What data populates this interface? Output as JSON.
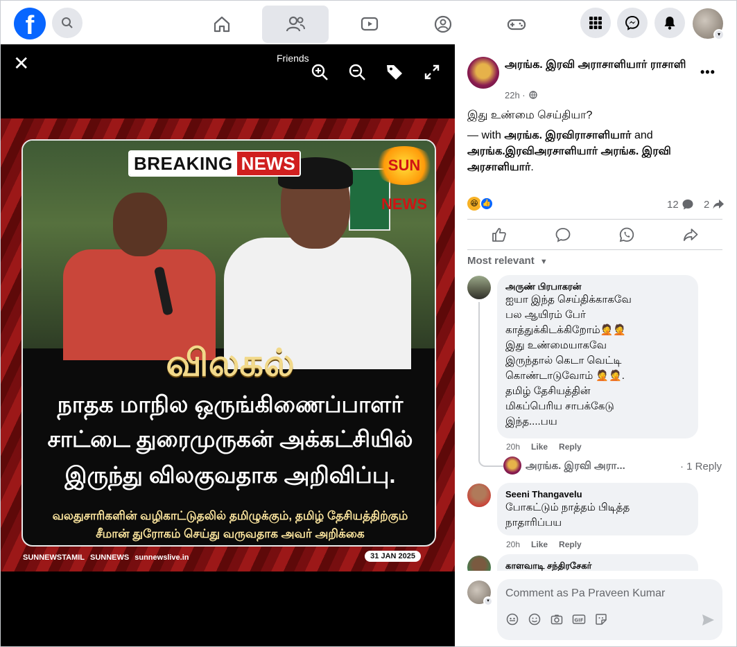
{
  "topbar": {
    "logo_letter": "f",
    "icons": [
      "search-icon",
      "home-icon",
      "friends-icon",
      "video-icon",
      "groups-icon",
      "gaming-icon",
      "menu-grid-icon",
      "messenger-icon",
      "bell-icon"
    ]
  },
  "viewer": {
    "close_glyph": "✕",
    "tooltip": "Friends",
    "photo": {
      "breaking_left": "BREAKING",
      "breaking_right": "NEWS",
      "channel_logo": "SUN NEWS",
      "word": "விலகல்",
      "headline_1": "நாதக மாநில ஒருங்கிணைப்பாளர்",
      "headline_2": "சாட்டை துரைமுருகன் அக்கட்சியில்",
      "headline_3": "இருந்து விலகுவதாக அறிவிப்பு.",
      "sub_1": "வலதுசாரிகளின் வழிகாட்டுதலில் தமிழுக்கும், தமிழ் தேசியத்திற்கும்",
      "sub_2": "சீமான் துரோகம் செய்து வருவதாக அவர் அறிக்கை",
      "footer_1": "SUNNEWSTAMIL",
      "footer_2": "SUNNEWS",
      "footer_3": "sunnewslive.in",
      "date": "31 JAN 2025"
    }
  },
  "post": {
    "author": "அரங்க. இரவி அராசாளியார் ராசாளி",
    "time": "22h ·",
    "more": "•••",
    "text": "இது உண்மை செய்தியா?",
    "with_prefix": "— with ",
    "tag1": "அரங்க. இரவிராசாளியார்",
    "and": " and ",
    "tag2": "அரங்க.இரவிஅரசாளியார் அரங்க. இரவி அரசாளியார்",
    "period": ".",
    "comments_count": "12",
    "shares_count": "2",
    "sort_label": "Most relevant"
  },
  "comments": [
    {
      "name": "அருண் பிரபாகரன்",
      "lines": [
        "ஐயா இந்த செய்திக்காகவே",
        "பல ஆயிரம் பேர்",
        "காத்துக்கிடக்கிறோம்🤦🤦",
        "இது உண்மையாகவே",
        "இருந்தால் கெடா வெட்டி",
        "கொண்டாடுவோம் 🤦🤦.",
        "தமிழ் தேசியத்தின்",
        "மிகப்பெரிய சாபக்கேடு",
        "இந்த....பய"
      ],
      "time": "20h",
      "like": "Like",
      "reply": "Reply"
    },
    {
      "name": "Seeni Thangavelu",
      "lines": [
        "போகட்டும் நாத்தம் பிடித்த",
        "நாதாரிப்பய"
      ],
      "time": "20h",
      "like": "Like",
      "reply": "Reply"
    },
    {
      "name": "காளவாடி சந்திரசேகர்"
    }
  ],
  "reply_preview": {
    "name": "அரங்க. இரவி அரா...",
    "count": "· 1 Reply"
  },
  "composer": {
    "placeholder": "Comment as Pa Praveen Kumar"
  },
  "colors": {
    "brand": "#0866ff",
    "muted": "#65676b",
    "bubble": "#f0f2f5"
  }
}
